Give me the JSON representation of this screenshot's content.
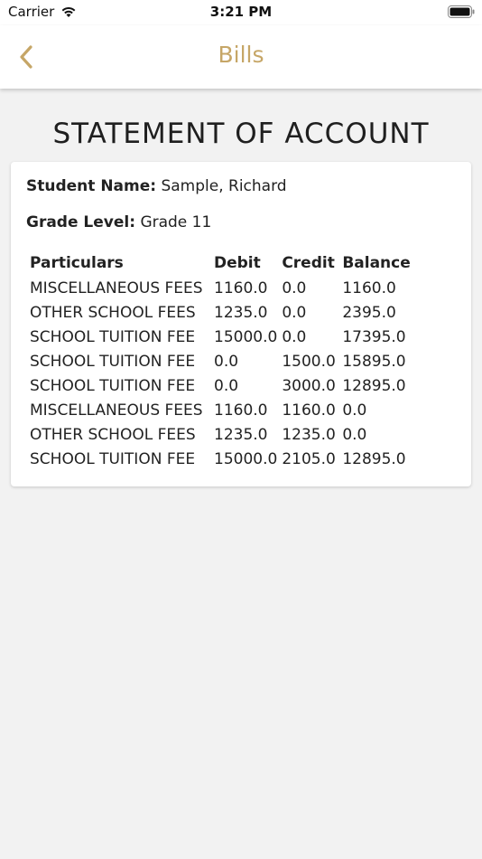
{
  "status_bar": {
    "carrier": "Carrier",
    "time": "3:21 PM",
    "icons": [
      "wifi-icon",
      "battery-icon"
    ]
  },
  "nav": {
    "back_icon": "chevron-left-icon",
    "title": "Bills",
    "accent_color": "#c6a667"
  },
  "statement": {
    "heading": "STATEMENT OF ACCOUNT",
    "student_label": "Student Name:",
    "student_value": "Sample, Richard",
    "grade_label": "Grade Level:",
    "grade_value": "Grade 11",
    "columns": [
      "Particulars",
      "Debit",
      "Credit",
      "Balance"
    ],
    "rows": [
      [
        "MISCELLANEOUS FEES",
        "1160.0",
        "0.0",
        "1160.0"
      ],
      [
        "OTHER SCHOOL FEES",
        "1235.0",
        "0.0",
        "2395.0"
      ],
      [
        "SCHOOL TUITION FEE",
        "15000.0",
        "0.0",
        "17395.0"
      ],
      [
        "SCHOOL TUITION FEE",
        "0.0",
        "1500.0",
        "15895.0"
      ],
      [
        "SCHOOL TUITION FEE",
        "0.0",
        "3000.0",
        "12895.0"
      ],
      [
        "MISCELLANEOUS FEES",
        "1160.0",
        "1160.0",
        "0.0"
      ],
      [
        "OTHER SCHOOL FEES",
        "1235.0",
        "1235.0",
        "0.0"
      ],
      [
        "SCHOOL TUITION FEE",
        "15000.0",
        "2105.0",
        "12895.0"
      ]
    ]
  }
}
